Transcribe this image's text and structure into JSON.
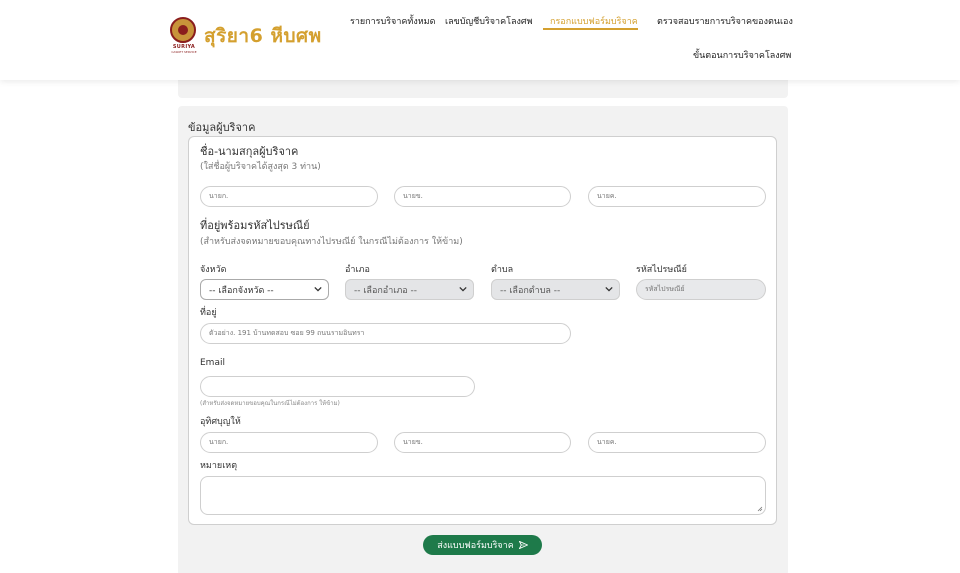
{
  "brand": {
    "logo_caption": "SURIYA",
    "logo_subcaption": "CASKET SERVICE",
    "name": "สุริยา6 หีบศพ"
  },
  "nav": {
    "items": [
      {
        "label": "รายการบริจาคทั้งหมด",
        "active": false
      },
      {
        "label": "เลขบัญชีบริจาคโลงศพ",
        "active": false
      },
      {
        "label": "กรอกแบบฟอร์มบริจาค",
        "active": true
      },
      {
        "label": "ตรวจสอบรายการบริจาคของตนเอง",
        "active": false
      },
      {
        "label": "ขั้นตอนการบริจาคโลงศพ",
        "active": false
      }
    ]
  },
  "form": {
    "section_title": "ข้อมูลผู้บริจาค",
    "donor": {
      "label": "ชื่อ-นามสกุลผู้บริจาค",
      "hint": "(ใส่ชื่อผู้บริจาคได้สูงสุด 3 ท่าน)",
      "placeholders": [
        "นายก.",
        "นายข.",
        "นายค."
      ]
    },
    "address_section": {
      "label": "ที่อยู่พร้อมรหัสไปรษณีย์",
      "hint": "(สำหรับส่งจดหมายขอบคุณทางไปรษณีย์ ในกรณีไม่ต้องการ ให้ข้าม)"
    },
    "province": {
      "label": "จังหวัด",
      "value": "-- เลือกจังหวัด --"
    },
    "district": {
      "label": "อำเภอ",
      "value": "-- เลือกอำเภอ --"
    },
    "subdistrict": {
      "label": "ตำบล",
      "value": "-- เลือกตำบล --"
    },
    "postcode": {
      "label": "รหัสไปรษณีย์",
      "placeholder": "รหัสไปรษณีย์"
    },
    "address": {
      "label": "ที่อยู่",
      "placeholder": "ตัวอย่าง. 191 บ้านทดสอบ ซอย 99 ถนนรามอินทรา"
    },
    "email": {
      "label": "Email",
      "hint": "(สำหรับส่งจดหมายขอบคุณในกรณีไม่ต้องการ ให้ข้าม)"
    },
    "dedication": {
      "label": "อุทิศบุญให้",
      "placeholders": [
        "นายก.",
        "นายข.",
        "นายค."
      ]
    },
    "remarks": {
      "label": "หมายเหตุ"
    },
    "submit_label": "ส่งแบบฟอร์มบริจาค"
  },
  "colors": {
    "accent": "#d4a02f",
    "submit": "#1e7a4a",
    "panel": "#f2f2f2"
  }
}
